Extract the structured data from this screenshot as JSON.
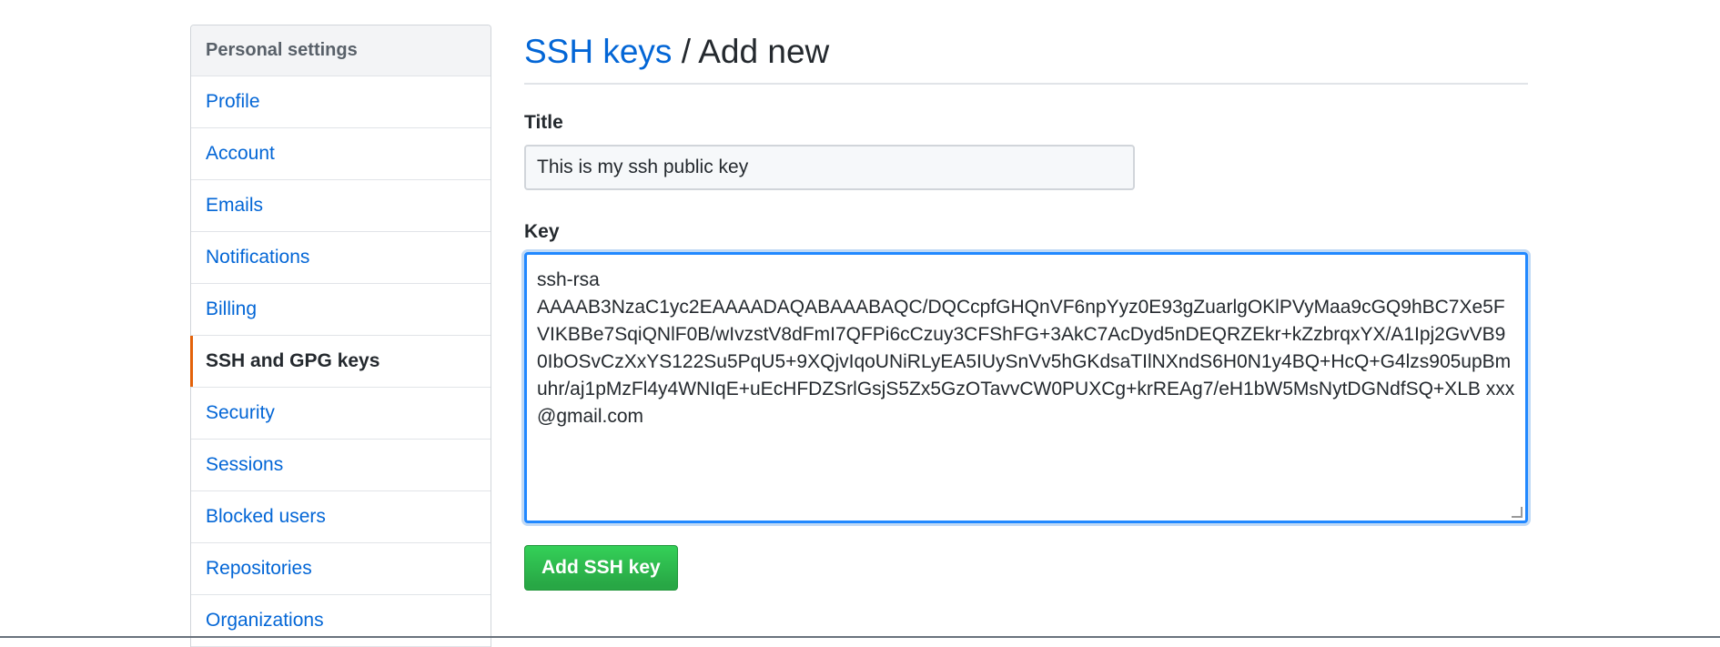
{
  "sidebar": {
    "header": "Personal settings",
    "items": [
      {
        "label": "Profile"
      },
      {
        "label": "Account"
      },
      {
        "label": "Emails"
      },
      {
        "label": "Notifications"
      },
      {
        "label": "Billing"
      },
      {
        "label": "SSH and GPG keys",
        "selected": true
      },
      {
        "label": "Security"
      },
      {
        "label": "Sessions"
      },
      {
        "label": "Blocked users"
      },
      {
        "label": "Repositories"
      },
      {
        "label": "Organizations"
      }
    ]
  },
  "main": {
    "breadcrumb_link": "SSH keys",
    "breadcrumb_separator": "/",
    "breadcrumb_current": "Add new",
    "title_label": "Title",
    "title_value": "This is my ssh public key",
    "key_label": "Key",
    "key_value": "ssh-rsa\nAAAAB3NzaC1yc2EAAAADAQABAAABAQC/DQCcpfGHQnVF6npYyz0E93gZuarlgOKlPVyMaa9cGQ9hBC7Xe5FVIKBBe7SqiQNlF0B/wIvzstV8dFmI7QFPi6cCzuy3CFShFG+3AkC7AcDyd5nDEQRZEkr+kZzbrqxYX/A1Ipj2GvVB90IbOSvCzXxYS122Su5PqU5+9XQjvIqoUNiRLyEA5IUySnVv5hGKdsaTIlNXndS6H0N1y4BQ+HcQ+G4lzs905upBmuhr/aj1pMzFl4y4WNIqE+uEcHFDZSrlGsjS5Zx5GzOTavvCW0PUXCg+krREAg7/eH1bW5MsNytDGNdfSQ+XLB xxx@gmail.com",
    "submit_label": "Add SSH key"
  },
  "colors": {
    "link": "#0366d6",
    "selected_accent": "#e36209",
    "button_green": "#28a745",
    "focus_border": "#2188ff"
  }
}
